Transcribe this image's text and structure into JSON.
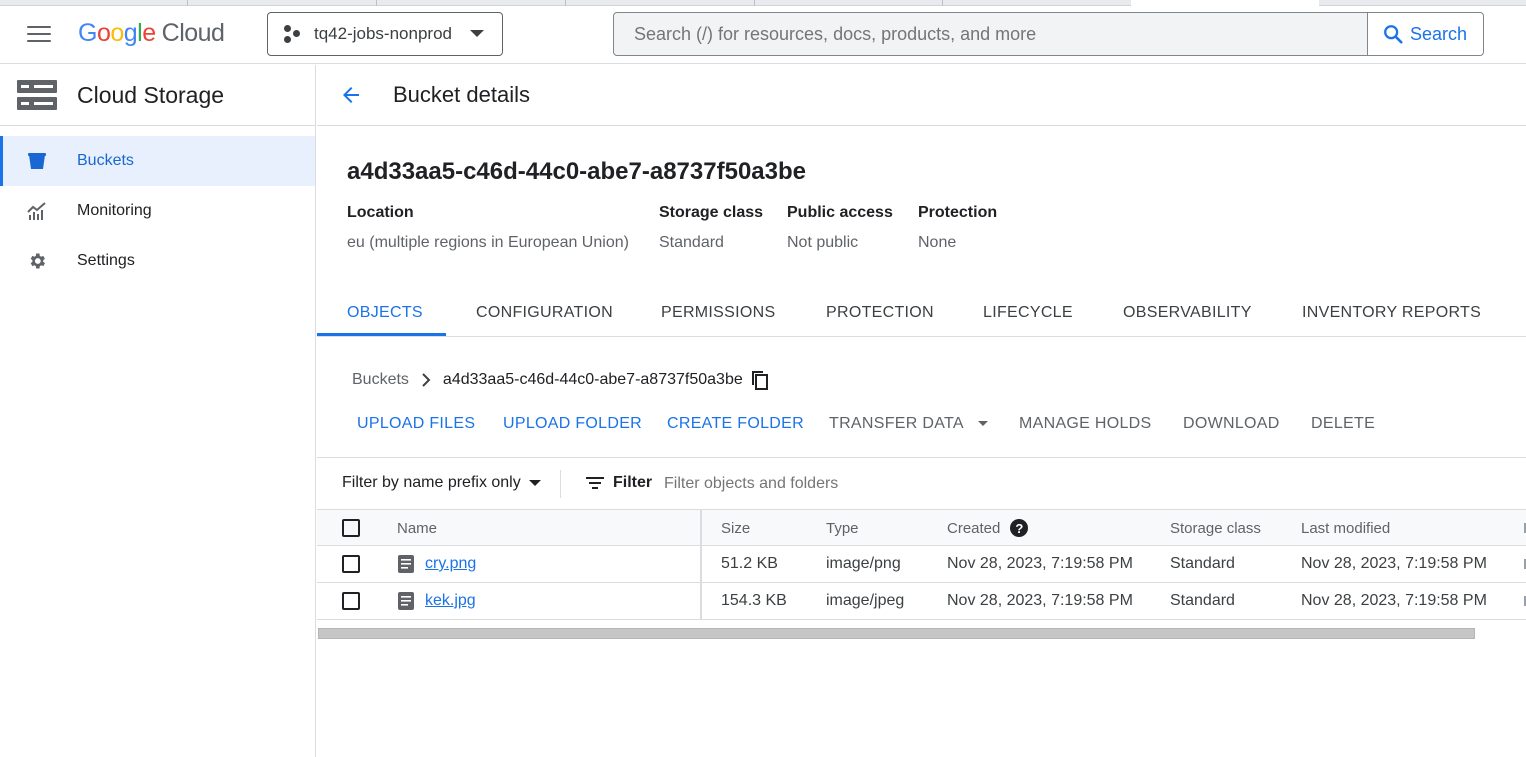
{
  "header": {
    "logo": {
      "letters": [
        "G",
        "o",
        "o",
        "g",
        "l",
        "e"
      ],
      "suffix": "Cloud"
    },
    "project": "tq42-jobs-nonprod",
    "search_placeholder": "Search (/) for resources, docs, products, and more",
    "search_button": "Search"
  },
  "sidebar": {
    "title": "Cloud Storage",
    "items": [
      {
        "label": "Buckets",
        "icon": "bucket-icon",
        "active": true
      },
      {
        "label": "Monitoring",
        "icon": "monitoring-icon",
        "active": false
      },
      {
        "label": "Settings",
        "icon": "gear-icon",
        "active": false
      }
    ]
  },
  "page": {
    "title": "Bucket details",
    "bucket_name": "a4d33aa5-c46d-44c0-abe7-a8737f50a3be",
    "meta": [
      {
        "key": "Location",
        "value": "eu (multiple regions in European Union)"
      },
      {
        "key": "Storage class",
        "value": "Standard"
      },
      {
        "key": "Public access",
        "value": "Not public"
      },
      {
        "key": "Protection",
        "value": "None"
      }
    ]
  },
  "tabs": [
    "OBJECTS",
    "CONFIGURATION",
    "PERMISSIONS",
    "PROTECTION",
    "LIFECYCLE",
    "OBSERVABILITY",
    "INVENTORY REPORTS"
  ],
  "active_tab": "OBJECTS",
  "breadcrumb": {
    "root": "Buckets",
    "current": "a4d33aa5-c46d-44c0-abe7-a8737f50a3be"
  },
  "actions": {
    "upload_files": "UPLOAD FILES",
    "upload_folder": "UPLOAD FOLDER",
    "create_folder": "CREATE FOLDER",
    "transfer_data": "TRANSFER DATA",
    "manage_holds": "MANAGE HOLDS",
    "download": "DOWNLOAD",
    "delete": "DELETE"
  },
  "filter": {
    "mode": "Filter by name prefix only",
    "button": "Filter",
    "placeholder": "Filter objects and folders"
  },
  "table": {
    "columns": {
      "name": "Name",
      "size": "Size",
      "type": "Type",
      "created": "Created",
      "storage_class": "Storage class",
      "last_modified": "Last modified"
    },
    "rows": [
      {
        "name": "cry.png",
        "size": "51.2 KB",
        "type": "image/png",
        "created": "Nov 28, 2023, 7:19:58 PM",
        "storage_class": "Standard",
        "last_modified": "Nov 28, 2023, 7:19:58 PM"
      },
      {
        "name": "kek.jpg",
        "size": "154.3 KB",
        "type": "image/jpeg",
        "created": "Nov 28, 2023, 7:19:58 PM",
        "storage_class": "Standard",
        "last_modified": "Nov 28, 2023, 7:19:58 PM"
      }
    ]
  },
  "colors": {
    "accent": "#1a73e8",
    "active_nav_bg": "#e8f0fe"
  }
}
